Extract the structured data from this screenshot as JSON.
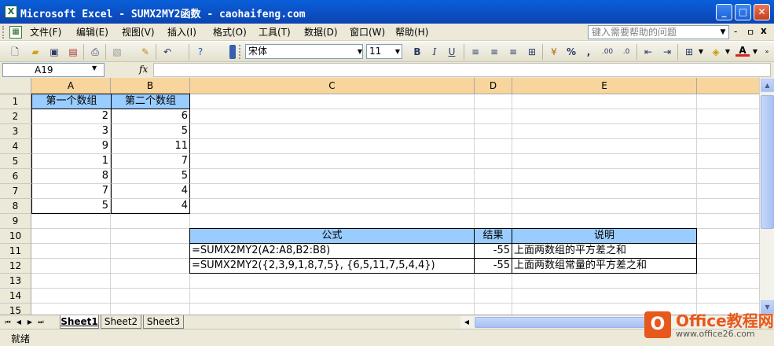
{
  "window": {
    "title": "Microsoft Excel - SUMX2MY2函数 - caohaifeng.com",
    "icon": "excel-icon",
    "buttons": [
      "_",
      "□",
      "✕"
    ]
  },
  "menu": {
    "items": [
      "文件(F)",
      "编辑(E)",
      "视图(V)",
      "插入(I)",
      "格式(O)",
      "工具(T)",
      "数据(D)",
      "窗口(W)",
      "帮助(H)"
    ],
    "help_placeholder": "键入需要帮助的问题",
    "doc_buttons": [
      "-",
      "ㅁ",
      "x"
    ]
  },
  "toolbar": {
    "font_name": "宋体",
    "font_size": "11",
    "bold": "B",
    "italic": "I",
    "underline": "U",
    "percent": "%",
    "comma": ",",
    "font_color_letter": "A"
  },
  "formula_bar": {
    "name_box": "A19",
    "fx": "fx",
    "content": ""
  },
  "sheet": {
    "columns": [
      "A",
      "B",
      "C",
      "D",
      "E"
    ],
    "rows": [
      "1",
      "2",
      "3",
      "4",
      "5",
      "6",
      "7",
      "8",
      "9",
      "10",
      "11",
      "12",
      "13",
      "14",
      "15"
    ],
    "A1": "第一个数组",
    "B1": "第二个数组",
    "A_values": [
      "2",
      "3",
      "9",
      "1",
      "8",
      "7",
      "5"
    ],
    "B_values": [
      "6",
      "5",
      "11",
      "7",
      "5",
      "4",
      "4"
    ],
    "C10": "公式",
    "D10": "结果",
    "E10": "说明",
    "C11": "=SUMX2MY2(A2:A8,B2:B8)",
    "D11": "-55",
    "E11": "上面两数组的平方差之和",
    "C12": "=SUMX2MY2({2,3,9,1,8,7,5}, {6,5,11,7,5,4,4})",
    "D12": "-55",
    "E12": "上面两数组常量的平方差之和"
  },
  "tabs": [
    "Sheet1",
    "Sheet2",
    "Sheet3"
  ],
  "status": "就绪",
  "watermark": {
    "name": "Office教程网",
    "url": "www.office26.com"
  }
}
